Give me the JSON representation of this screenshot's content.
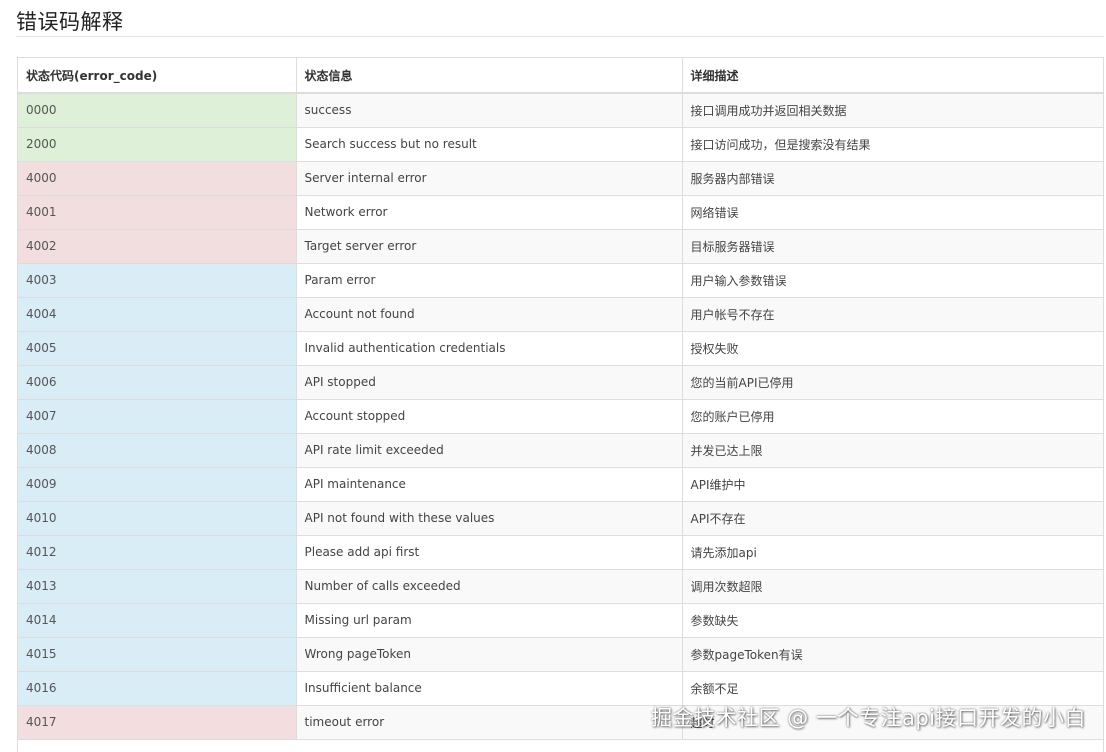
{
  "page": {
    "title": "错误码解释"
  },
  "table": {
    "headers": [
      "状态代码(error_code)",
      "状态信息",
      "详细描述"
    ],
    "rows": [
      {
        "code": "0000",
        "message": "success",
        "description": "接口调用成功并返回相关数据",
        "status": "success"
      },
      {
        "code": "2000",
        "message": "Search success but no result",
        "description": "接口访问成功，但是搜索没有结果",
        "status": "success"
      },
      {
        "code": "4000",
        "message": "Server internal error",
        "description": "服务器内部错误",
        "status": "danger"
      },
      {
        "code": "4001",
        "message": "Network error",
        "description": "网络错误",
        "status": "danger"
      },
      {
        "code": "4002",
        "message": "Target server error",
        "description": "目标服务器错误",
        "status": "danger"
      },
      {
        "code": "4003",
        "message": "Param error",
        "description": "用户输入参数错误",
        "status": "info"
      },
      {
        "code": "4004",
        "message": "Account not found",
        "description": "用户帐号不存在",
        "status": "info"
      },
      {
        "code": "4005",
        "message": "Invalid authentication credentials",
        "description": "授权失败",
        "status": "info"
      },
      {
        "code": "4006",
        "message": "API stopped",
        "description": "您的当前API已停用",
        "status": "info"
      },
      {
        "code": "4007",
        "message": "Account stopped",
        "description": "您的账户已停用",
        "status": "info"
      },
      {
        "code": "4008",
        "message": "API rate limit exceeded",
        "description": "并发已达上限",
        "status": "info"
      },
      {
        "code": "4009",
        "message": "API maintenance",
        "description": "API维护中",
        "status": "info"
      },
      {
        "code": "4010",
        "message": "API not found with these values",
        "description": "API不存在",
        "status": "info"
      },
      {
        "code": "4012",
        "message": "Please add api first",
        "description": "请先添加api",
        "status": "info"
      },
      {
        "code": "4013",
        "message": "Number of calls exceeded",
        "description": "调用次数超限",
        "status": "info"
      },
      {
        "code": "4014",
        "message": "Missing url param",
        "description": "参数缺失",
        "status": "info"
      },
      {
        "code": "4015",
        "message": "Wrong pageToken",
        "description": "参数pageToken有误",
        "status": "info"
      },
      {
        "code": "4016",
        "message": "Insufficient balance",
        "description": "余额不足",
        "status": "info"
      },
      {
        "code": "4017",
        "message": "timeout error",
        "description": "超时",
        "status": "danger"
      }
    ]
  },
  "colors": {
    "success": "#dff0d8",
    "danger": "#f2dede",
    "info": "#d9edf7",
    "border": "#dddddd",
    "stripe": "#f9f9f9"
  },
  "watermark": {
    "text": "掘金技术社区 @ 一个专注api接口开发的小白"
  }
}
